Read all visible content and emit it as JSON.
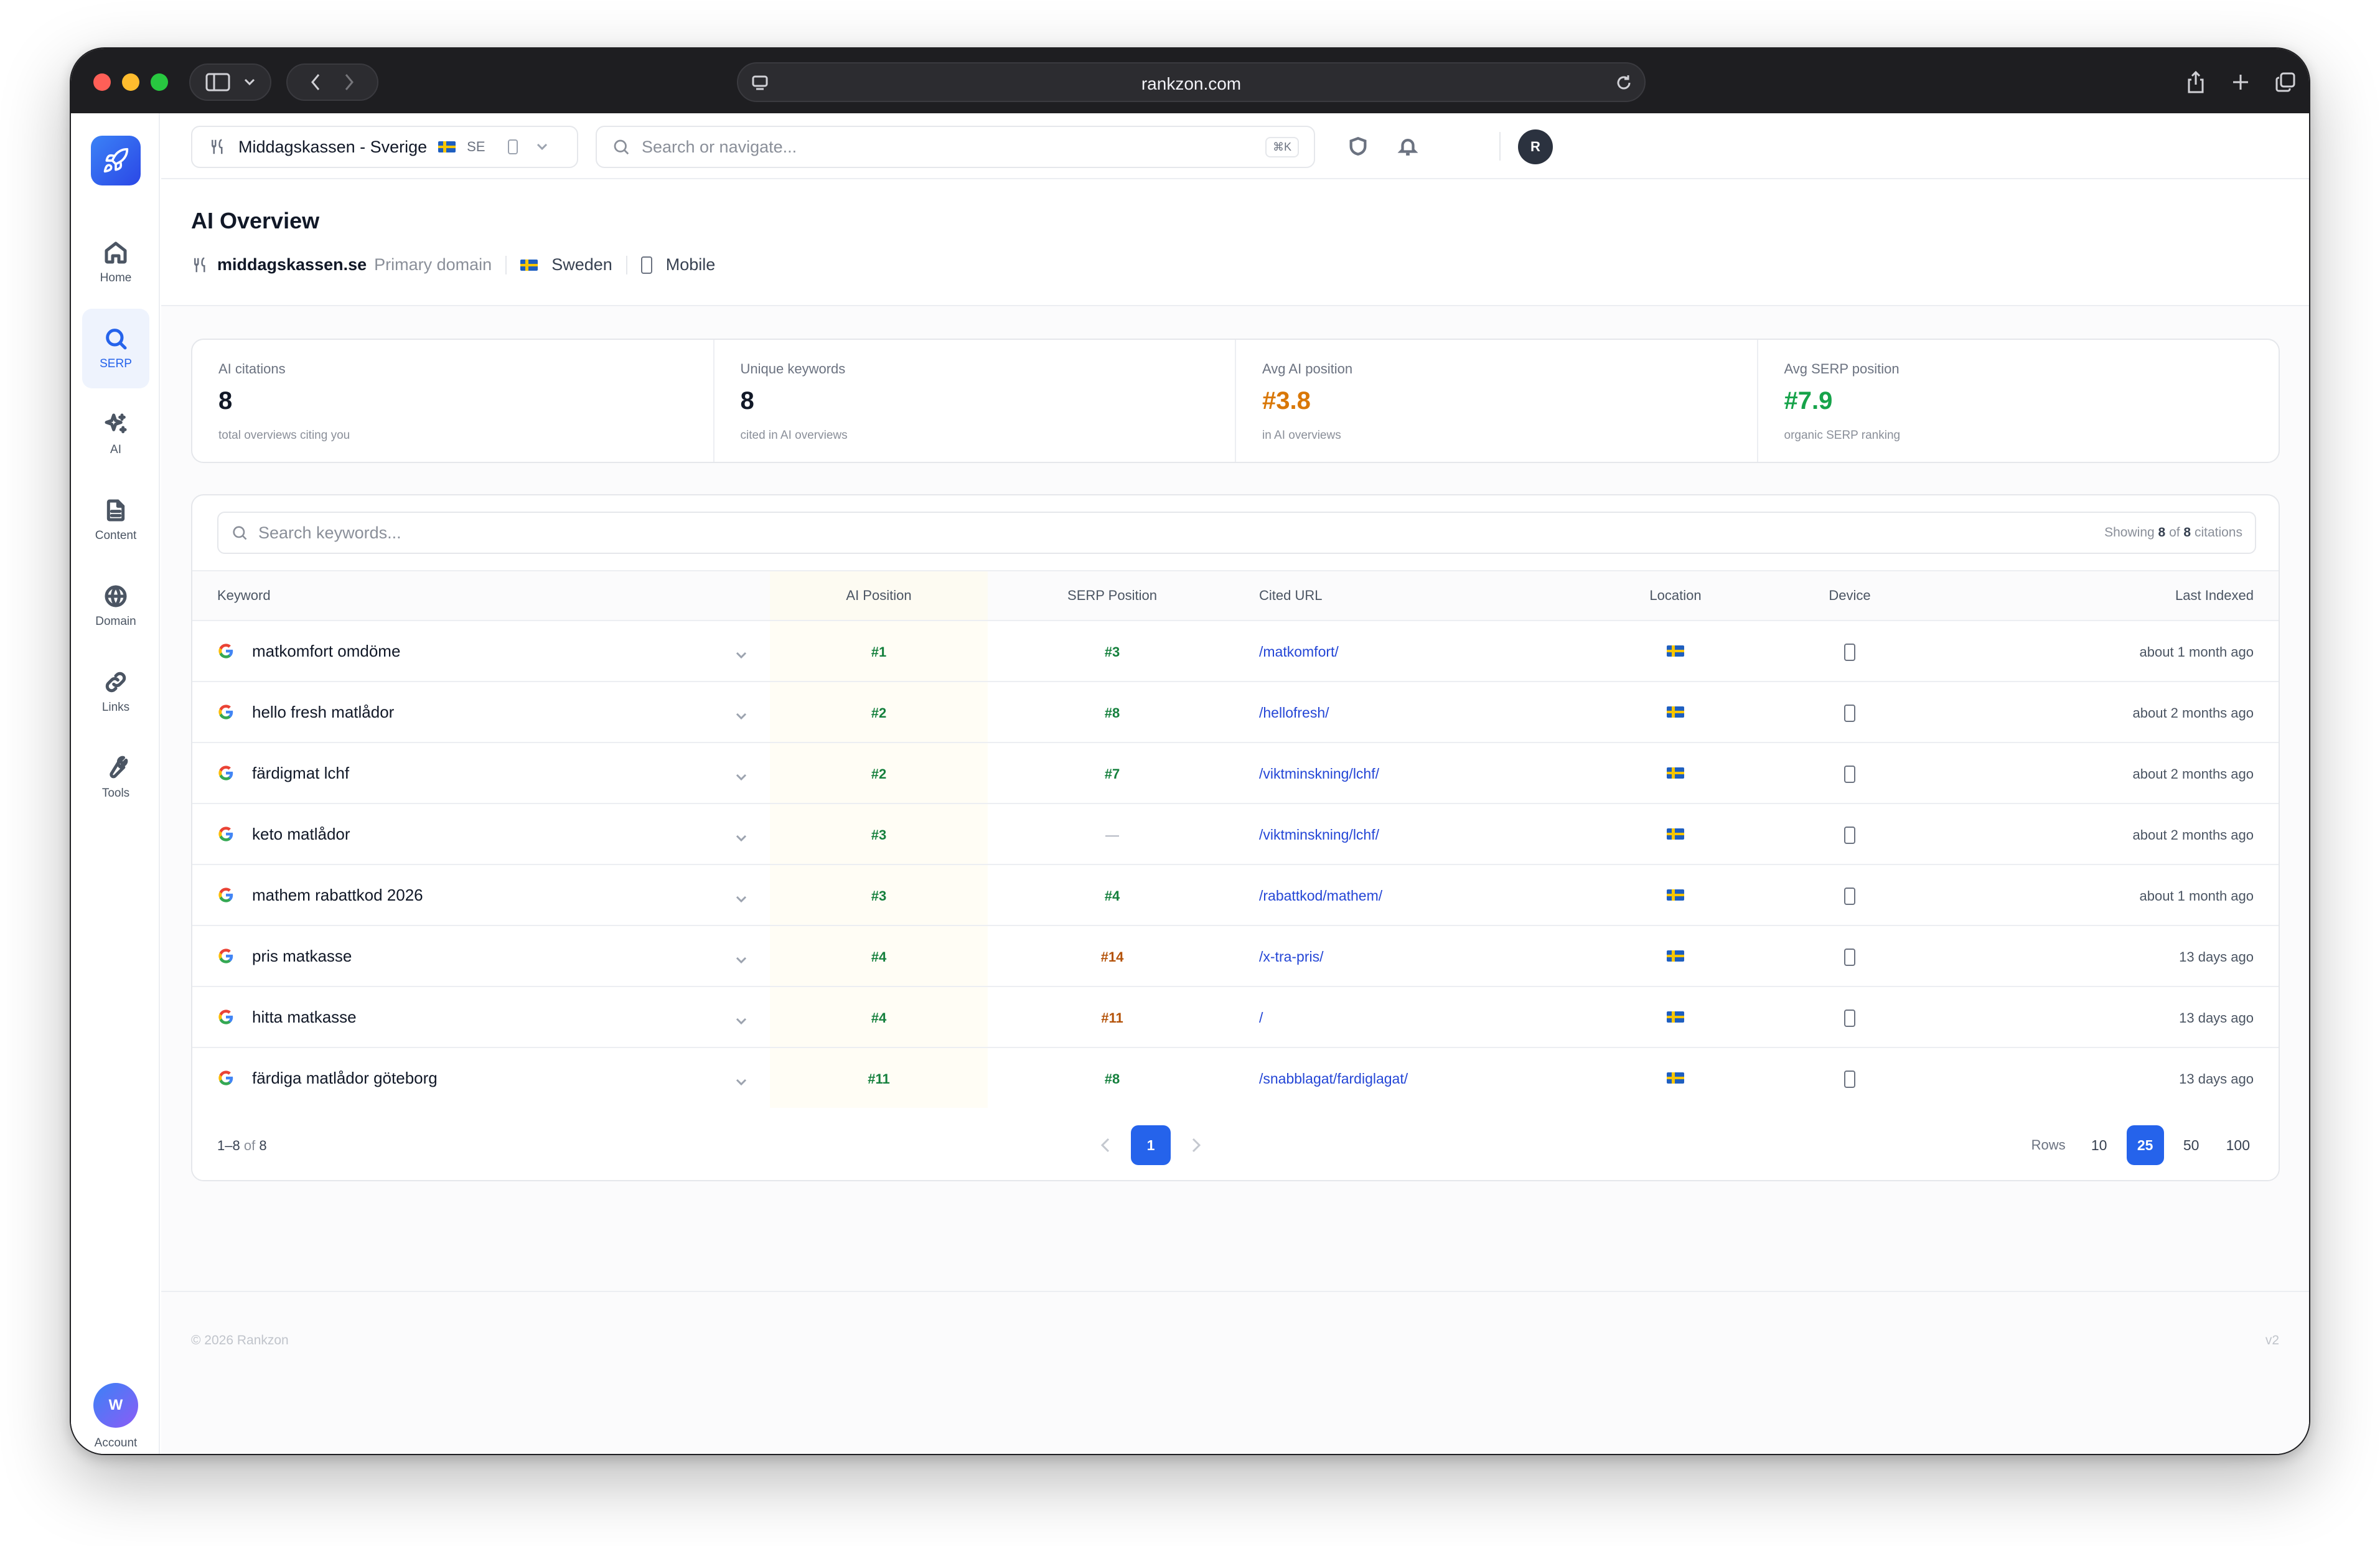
{
  "browser": {
    "url": "rankzon.com"
  },
  "sidebar": {
    "items": [
      {
        "label": "Home",
        "icon": "home-icon",
        "active": false
      },
      {
        "label": "SERP",
        "icon": "search-icon",
        "active": true
      },
      {
        "label": "AI",
        "icon": "sparkles-icon",
        "active": false
      },
      {
        "label": "Content",
        "icon": "document-icon",
        "active": false
      },
      {
        "label": "Domain",
        "icon": "globe-icon",
        "active": false
      },
      {
        "label": "Links",
        "icon": "link-icon",
        "active": false
      },
      {
        "label": "Tools",
        "icon": "wrench-icon",
        "active": false
      }
    ],
    "account": {
      "label": "Account",
      "initial": "W"
    }
  },
  "topbar": {
    "project": "Middagskassen - Sverige",
    "project_country": "SE",
    "search_placeholder": "Search or navigate...",
    "shortcut": "⌘K",
    "user_initial": "R"
  },
  "header": {
    "title": "AI Overview",
    "domain": "middagskassen.se",
    "domain_tag": "Primary domain",
    "country": "Sweden",
    "device": "Mobile"
  },
  "stats": [
    {
      "label": "AI citations",
      "value": "8",
      "sub": "total overviews citing you",
      "tone": "default"
    },
    {
      "label": "Unique keywords",
      "value": "8",
      "sub": "cited in AI overviews",
      "tone": "default"
    },
    {
      "label": "Avg AI position",
      "value": "#3.8",
      "sub": "in AI overviews",
      "tone": "orange"
    },
    {
      "label": "Avg SERP position",
      "value": "#7.9",
      "sub": "organic SERP ranking",
      "tone": "green"
    }
  ],
  "table": {
    "search_placeholder": "Search keywords...",
    "showing_prefix": "Showing",
    "showing_count": "8",
    "showing_of": "of",
    "showing_total": "8",
    "showing_suffix": "citations",
    "columns": {
      "keyword": "Keyword",
      "ai_position": "AI Position",
      "serp_position": "SERP Position",
      "cited_url": "Cited URL",
      "location": "Location",
      "device": "Device",
      "last_indexed": "Last Indexed"
    },
    "rows": [
      {
        "keyword": "matkomfort omdöme",
        "ai": "#1",
        "serp": "#3",
        "serp_tone": "green",
        "url": "/matkomfort/",
        "last": "about 1 month ago"
      },
      {
        "keyword": "hello fresh matlådor",
        "ai": "#2",
        "serp": "#8",
        "serp_tone": "green",
        "url": "/hellofresh/",
        "last": "about 2 months ago"
      },
      {
        "keyword": "färdigmat lchf",
        "ai": "#2",
        "serp": "#7",
        "serp_tone": "green",
        "url": "/viktminskning/lchf/",
        "last": "about 2 months ago"
      },
      {
        "keyword": "keto matlådor",
        "ai": "#3",
        "serp": "—",
        "serp_tone": "dash",
        "url": "/viktminskning/lchf/",
        "last": "about 2 months ago"
      },
      {
        "keyword": "mathem rabattkod 2026",
        "ai": "#3",
        "serp": "#4",
        "serp_tone": "green",
        "url": "/rabattkod/mathem/",
        "last": "about 1 month ago"
      },
      {
        "keyword": "pris matkasse",
        "ai": "#4",
        "serp": "#14",
        "serp_tone": "orange",
        "url": "/x-tra-pris/",
        "last": "13 days ago"
      },
      {
        "keyword": "hitta matkasse",
        "ai": "#4",
        "serp": "#11",
        "serp_tone": "orange",
        "url": "/",
        "last": "13 days ago"
      },
      {
        "keyword": "färdiga matlådor göteborg",
        "ai": "#11",
        "serp": "#8",
        "serp_tone": "green",
        "url": "/snabblagat/fardiglagat/",
        "last": "13 days ago"
      }
    ]
  },
  "pagination": {
    "range": "1–8",
    "of_label": "of",
    "total": "8",
    "current_page": "1",
    "rows_label": "Rows",
    "rows_options": [
      "10",
      "25",
      "50",
      "100"
    ],
    "rows_selected": "25"
  },
  "footer": {
    "copyright": "© 2026 Rankzon",
    "version": "v2"
  },
  "colors": {
    "accent": "#2563eb",
    "positive": "#16a34a",
    "warning": "#d97706"
  }
}
